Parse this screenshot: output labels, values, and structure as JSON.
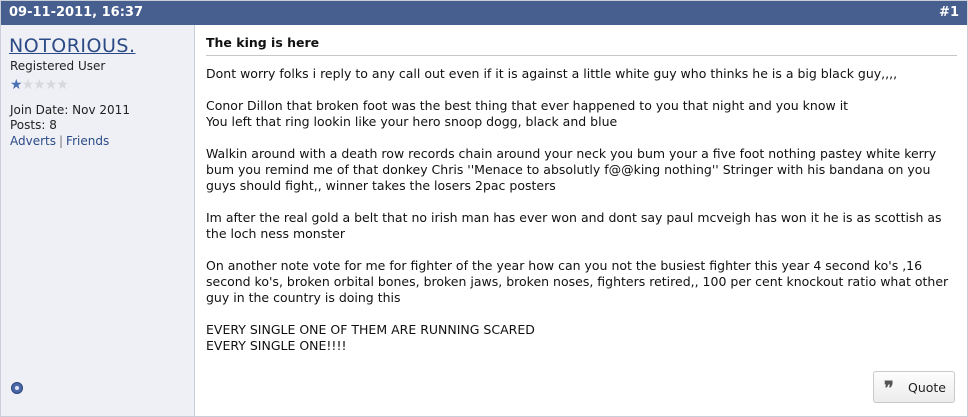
{
  "header": {
    "date": "09-11-2011, 16:37",
    "post_number": "#1"
  },
  "user": {
    "name": "NOTORIOUS.",
    "title": "Registered User",
    "reputation_stars": 1,
    "reputation_max": 5,
    "join_date": "Join Date: Nov 2011",
    "posts": "Posts: 8",
    "links": [
      "Adverts",
      "Friends"
    ],
    "status_icon": "offline-icon"
  },
  "post": {
    "title": "The king is here",
    "paragraphs": [
      "Dont worry folks i reply to any call out even if it is against a little white guy who thinks he is a big black guy,,,,",
      "Conor Dillon that broken foot was the best thing that ever happened to you that night and you know it\nYou left that ring lookin like your hero snoop dogg, black and blue",
      "Walkin around with a death row records chain around your neck you bum your a five foot nothing pastey white kerry bum you remind me of that donkey Chris ''Menace to absolutly f@@king nothing'' Stringer with his bandana on you guys should fight,, winner takes the losers 2pac posters",
      "Im after the real gold a belt that no irish man has ever won and dont say paul mcveigh has won it he is as scottish as the loch ness monster",
      "On another note vote for me for fighter of the year how can you not the busiest fighter this year 4 second ko's ,16 second ko's, broken orbital bones, broken jaws, broken noses, fighters retired,, 100 per cent knockout ratio what other guy in the country is doing this",
      "EVERY SINGLE ONE OF THEM ARE RUNNING SCARED\nEVERY SINGLE ONE!!!!"
    ]
  },
  "actions": {
    "quote_label": "Quote",
    "quote_icon": "quote-icon"
  },
  "colors": {
    "header_bg": "#475f8f",
    "sidebar_bg": "#eef0f5",
    "link": "#2c4a86"
  }
}
